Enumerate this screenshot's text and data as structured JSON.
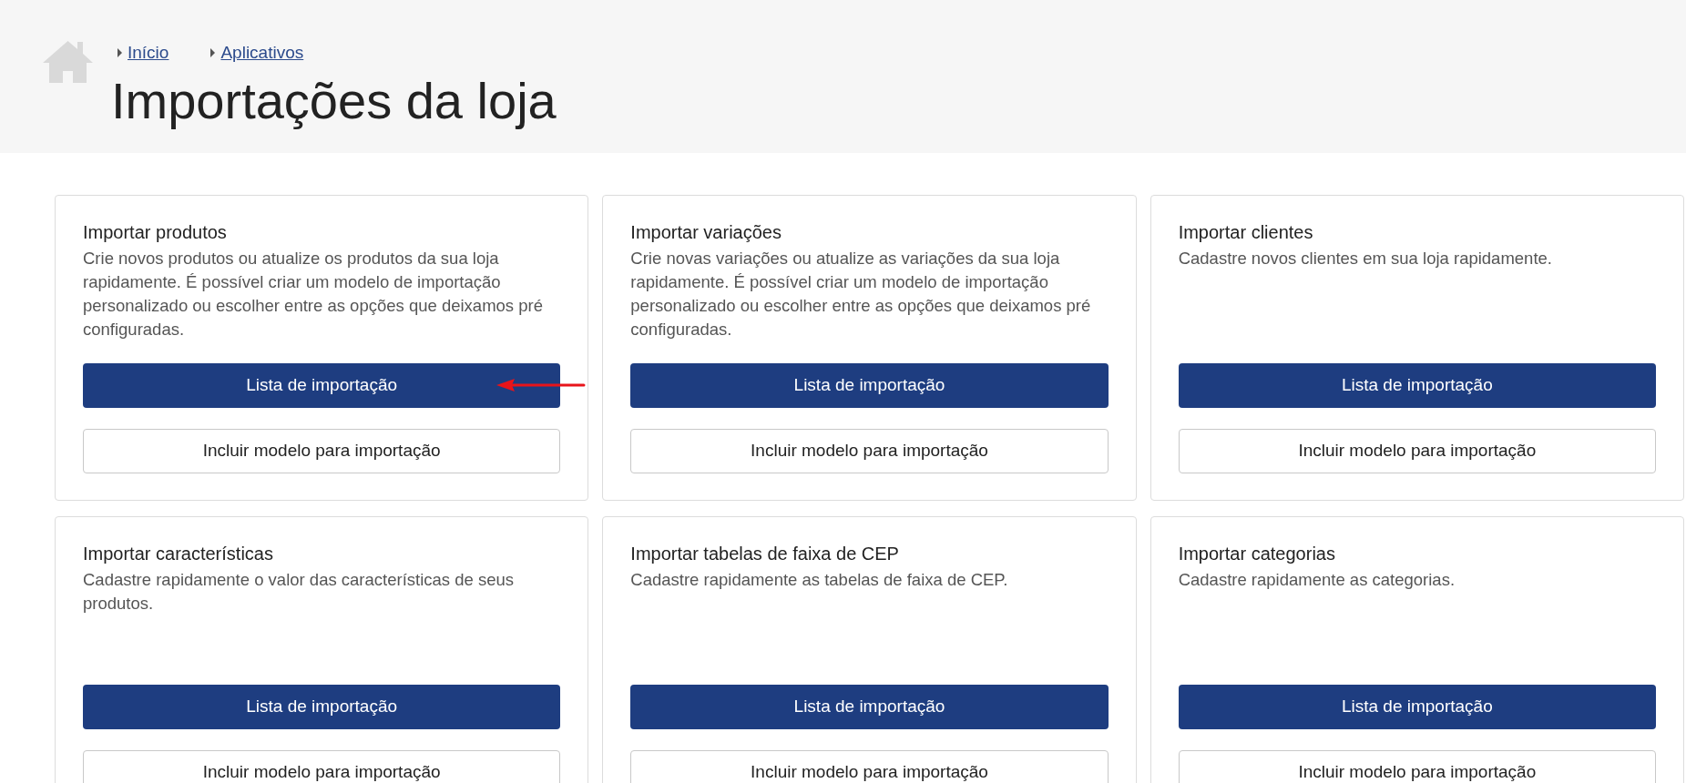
{
  "breadcrumb": [
    {
      "label": "Início"
    },
    {
      "label": "Aplicativos"
    }
  ],
  "title": "Importações da loja",
  "cards": [
    {
      "title": "Importar produtos",
      "description": "Crie novos produtos ou atualize os produtos da sua loja rapidamente. É possível criar um modelo de importação personalizado ou escolher entre as opções que deixamos pré configuradas.",
      "primary_button": "Lista de importação",
      "secondary_button": "Incluir modelo para importação"
    },
    {
      "title": "Importar variações",
      "description": "Crie novas variações ou atualize as variações da sua loja rapidamente. É possível criar um modelo de importação personalizado ou escolher entre as opções que deixamos pré configuradas.",
      "primary_button": "Lista de importação",
      "secondary_button": "Incluir modelo para importação"
    },
    {
      "title": "Importar clientes",
      "description": "Cadastre novos clientes em sua loja rapidamente.",
      "primary_button": "Lista de importação",
      "secondary_button": "Incluir modelo para importação"
    },
    {
      "title": "Importar características",
      "description": "Cadastre rapidamente o valor das características de seus produtos.",
      "primary_button": "Lista de importação",
      "secondary_button": "Incluir modelo para importação"
    },
    {
      "title": "Importar tabelas de faixa de CEP",
      "description": "Cadastre rapidamente as tabelas de faixa de CEP.",
      "primary_button": "Lista de importação",
      "secondary_button": "Incluir modelo para importação"
    },
    {
      "title": "Importar categorias",
      "description": "Cadastre rapidamente as categorias.",
      "primary_button": "Lista de importação",
      "secondary_button": "Incluir modelo para importação"
    }
  ]
}
